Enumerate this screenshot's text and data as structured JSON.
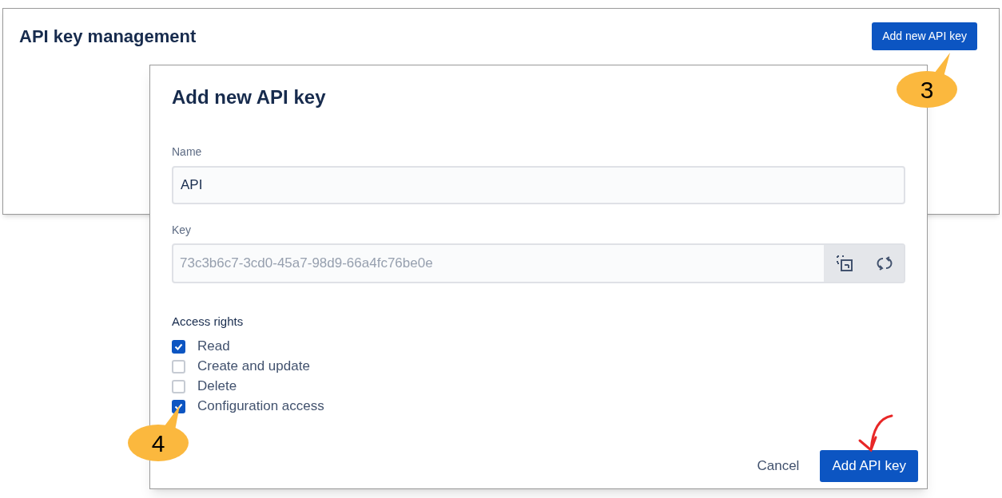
{
  "page": {
    "title": "API key management",
    "button": "Add new API key"
  },
  "dialog": {
    "title": "Add new API key",
    "name_field": {
      "label": "Name",
      "value": "API"
    },
    "key_field": {
      "label": "Key",
      "value": "73c3b6c7-3cd0-45a7-98d9-66a4fc76be0e"
    },
    "access": {
      "label": "Access rights",
      "options": [
        {
          "label": "Read",
          "checked": true
        },
        {
          "label": "Create and update",
          "checked": false
        },
        {
          "label": "Delete",
          "checked": false
        },
        {
          "label": "Configuration access",
          "checked": true
        }
      ]
    },
    "buttons": [
      {
        "label": "Cancel",
        "kind": "secondary"
      },
      {
        "label": "Add API key",
        "kind": "primary"
      }
    ]
  },
  "callouts": [
    {
      "number": "3"
    },
    {
      "number": "4"
    }
  ]
}
